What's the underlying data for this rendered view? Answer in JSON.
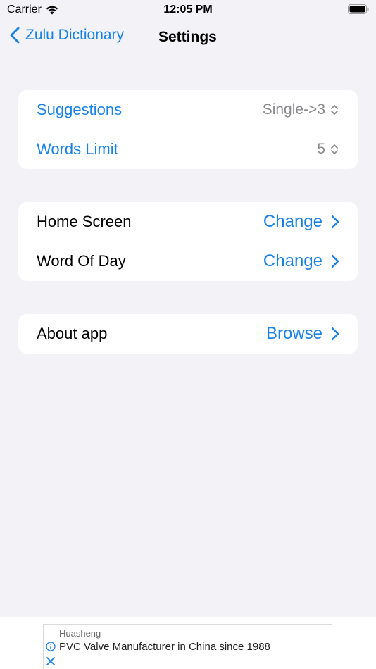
{
  "status_bar": {
    "carrier": "Carrier",
    "time": "12:05 PM"
  },
  "nav": {
    "back_label": "Zulu Dictionary",
    "title": "Settings"
  },
  "groups": [
    {
      "rows": [
        {
          "label": "Suggestions",
          "value": "Single->3"
        },
        {
          "label": "Words Limit",
          "value": "5"
        }
      ]
    },
    {
      "rows": [
        {
          "label": "Home Screen",
          "value": "Change"
        },
        {
          "label": "Word Of Day",
          "value": "Change"
        }
      ]
    },
    {
      "rows": [
        {
          "label": "About app",
          "value": "Browse"
        }
      ]
    }
  ],
  "ad": {
    "advertiser": "Huasheng",
    "headline": "PVC Valve Manufacturer in China since 1988"
  },
  "colors": {
    "accent": "#1a82e5",
    "background": "#f2f2f7",
    "secondary_text": "#8a8a8e"
  }
}
